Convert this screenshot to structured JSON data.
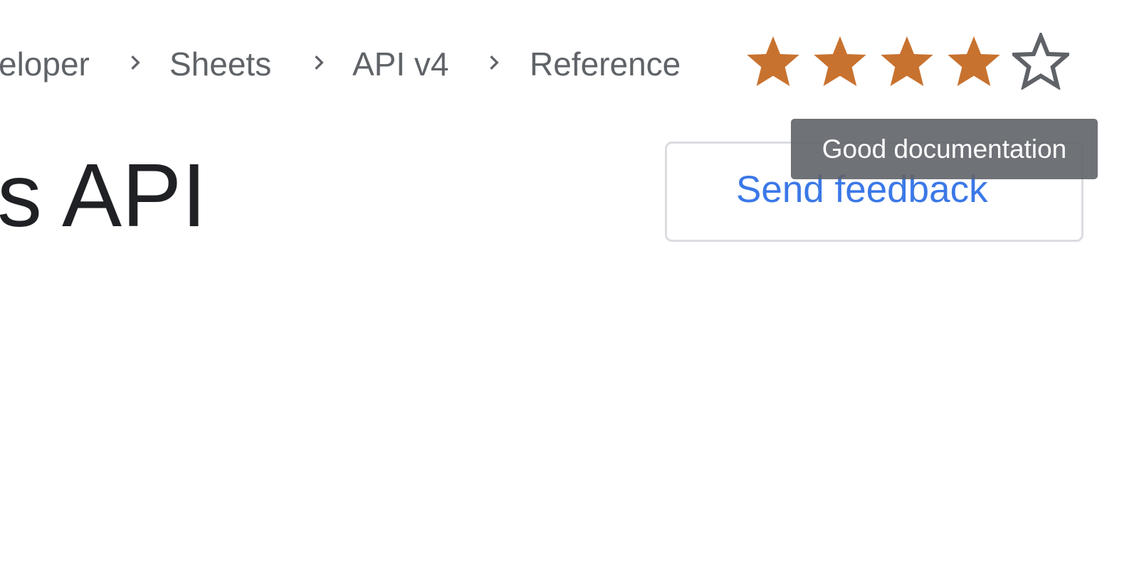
{
  "breadcrumb": {
    "items": [
      "eloper",
      "Sheets",
      "API v4",
      "Reference"
    ]
  },
  "page": {
    "title": "s API"
  },
  "rating": {
    "value": 4,
    "max": 5,
    "filled_color": "#c8722f",
    "empty_color": "#5f6368",
    "tooltip": "Good documentation"
  },
  "feedback": {
    "label": "Send feedback",
    "color": "#3b78e7"
  }
}
